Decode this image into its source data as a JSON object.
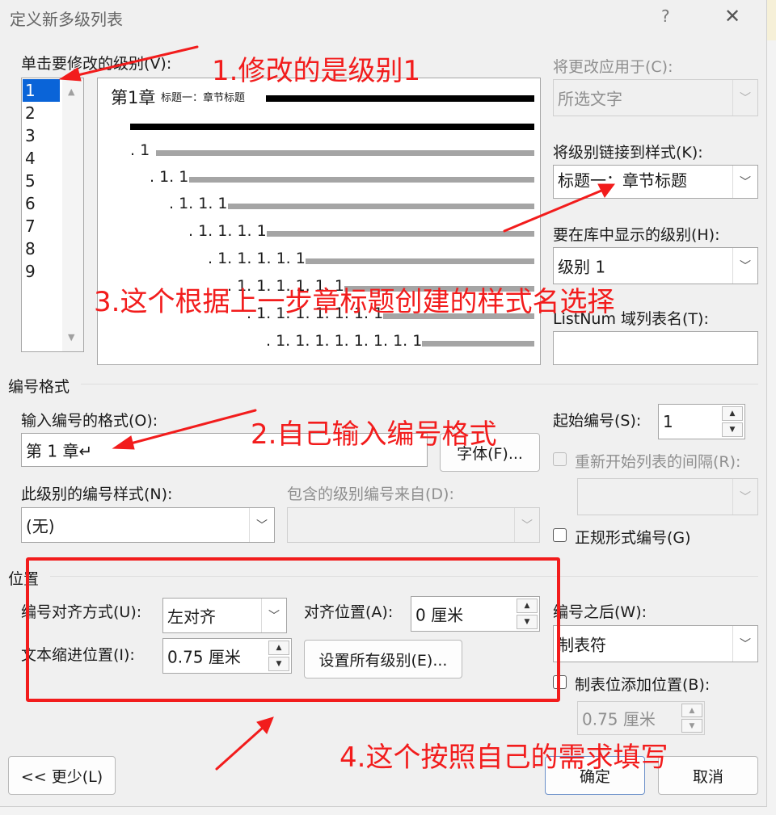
{
  "window": {
    "title": "定义新多级列表",
    "help": "?",
    "close": "✕"
  },
  "levels": {
    "label": "单击要修改的级别(V):",
    "items": [
      "1",
      "2",
      "3",
      "4",
      "5",
      "6",
      "7",
      "8",
      "9"
    ],
    "selected": "1"
  },
  "preview": {
    "level1_number": "第1章",
    "level1_style": "标题一：章节标题",
    "rows": [
      ". 1",
      ". 1. 1",
      ". 1. 1. 1",
      ". 1. 1. 1. 1",
      ". 1. 1. 1. 1. 1",
      ". 1. 1. 1. 1. 1. 1",
      ". 1. 1. 1. 1. 1. 1. 1",
      ". 1. 1. 1. 1. 1. 1. 1. 1"
    ]
  },
  "right": {
    "apply_label": "将更改应用于(C):",
    "apply_value": "所选文字",
    "link_label": "将级别链接到样式(K):",
    "link_value": "标题一：章节标题",
    "gallery_label": "要在库中显示的级别(H):",
    "gallery_value": "级别 1",
    "listnum_label": "ListNum 域列表名(T):",
    "listnum_value": ""
  },
  "number_format": {
    "section": "编号格式",
    "enter_label": "输入编号的格式(O):",
    "enter_value": "第 1 章↵",
    "font_button": "字体(F)...",
    "style_label": "此级别的编号样式(N):",
    "style_value": "(无)",
    "include_label": "包含的级别编号来自(D):",
    "include_value": "",
    "start_label": "起始编号(S):",
    "start_value": "1",
    "restart_label": "重新开始列表的间隔(R):",
    "restart_value": "",
    "legal_label": "正规形式编号(G)"
  },
  "position": {
    "section": "位置",
    "align_label": "编号对齐方式(U):",
    "align_value": "左对齐",
    "aligned_at_label": "对齐位置(A):",
    "aligned_at_value": "0 厘米",
    "indent_label": "文本缩进位置(I):",
    "indent_value": "0.75 厘米",
    "set_all_button": "设置所有级别(E)...",
    "follow_label": "编号之后(W):",
    "follow_value": "制表符",
    "tab_label": "制表位添加位置(B):",
    "tab_value": "0.75 厘米"
  },
  "footer": {
    "less_button": "<< 更少(L)",
    "ok_button": "确定",
    "cancel_button": "取消"
  },
  "annotations": {
    "a1": "1.修改的是级别1",
    "a2": "2.自己输入编号格式",
    "a3": "3.这个根据上一步章标题创建的样式名选择",
    "a4": "4.这个按照自己的需求填写",
    "color": "#f21c1c"
  }
}
